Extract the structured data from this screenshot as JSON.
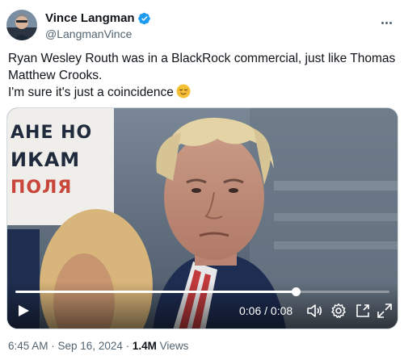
{
  "author": {
    "display_name": "Vince Langman",
    "handle": "@LangmanVince",
    "verified": true,
    "verified_color": "#1d9bf0"
  },
  "tweet": {
    "text_line1": "Ryan Wesley Routh was in a BlackRock commercial, just like Thomas Matthew Crooks.",
    "text_line2": "I'm sure it's just a coincidence",
    "emoji": "relieved-face"
  },
  "video": {
    "sign_text": [
      "АНЕ НО",
      "ИКАМ",
      "ПОЛЯ"
    ],
    "progress_fraction": 0.75,
    "time_label": "0:06 / 0:08",
    "icons": [
      "play-icon",
      "volume-icon",
      "settings-icon",
      "pop-out-icon",
      "fullscreen-icon"
    ]
  },
  "meta": {
    "time_date": "6:45 AM · Sep 16, 2024 · ",
    "views_count": "1.4M",
    "views_label": " Views"
  }
}
